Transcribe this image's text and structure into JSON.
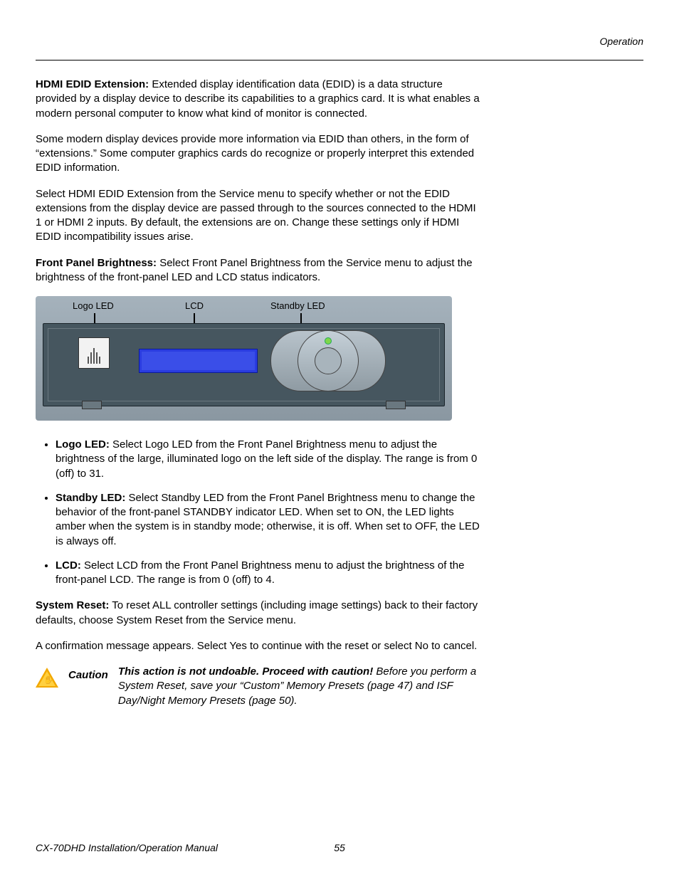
{
  "header": {
    "section": "Operation"
  },
  "p1": {
    "lead": "HDMI EDID Extension:",
    "body": " Extended display identification data (EDID) is a data structure provided by a display device to describe its capabilities to a graphics card. It is what enables a modern personal computer to know what kind of monitor is connected."
  },
  "p2": "Some modern display devices provide more information via EDID than others, in the form of “extensions.” Some computer graphics cards do recognize or properly interpret this extended EDID information.",
  "p3": "Select HDMI EDID Extension from the Service menu to specify whether or not the EDID extensions from the display device are passed through to the sources connected to the HDMI 1 or HDMI 2 inputs. By default, the extensions are on. Change these settings only if HDMI EDID incompatibility issues arise.",
  "p4": {
    "lead": "Front Panel Brightness:",
    "body": " Select Front Panel Brightness from the Service menu to adjust the brightness of the front-panel LED and LCD status indicators."
  },
  "diagram": {
    "labels": {
      "logo": "Logo LED",
      "lcd": "LCD",
      "standby": "Standby LED"
    }
  },
  "bullets": {
    "b1": {
      "lead": "Logo LED:",
      "body": " Select Logo LED from the Front Panel Brightness menu to adjust the brightness of the large, illuminated logo on the left side of the display. The range is from 0 (off) to 31."
    },
    "b2": {
      "lead": "Standby LED:",
      "body": " Select Standby LED from the Front Panel Brightness menu to change the behavior of the front-panel STANDBY indicator LED. When set to ON, the LED lights amber when the system is in standby mode; otherwise, it is off. When set to OFF, the LED is always off."
    },
    "b3": {
      "lead": "LCD:",
      "body": " Select LCD from the Front Panel Brightness menu to adjust the brightness of the front-panel LCD. The range is from 0 (off) to 4."
    }
  },
  "p5": {
    "lead": "System Reset:",
    "body": " To reset ALL controller settings (including image settings) back to their factory defaults, choose System Reset from the Service menu."
  },
  "p6": "A confirmation message appears. Select Yes to continue with the reset or select No to cancel.",
  "caution": {
    "label": "Caution",
    "lead": "This action is not undoable. Proceed with caution!",
    "body": " Before you perform a System Reset, save your “Custom” Memory Presets (page 47) and ISF Day/Night Memory Presets (page 50)."
  },
  "footer": {
    "title": "CX-70DHD Installation/Operation Manual",
    "page": "55"
  }
}
